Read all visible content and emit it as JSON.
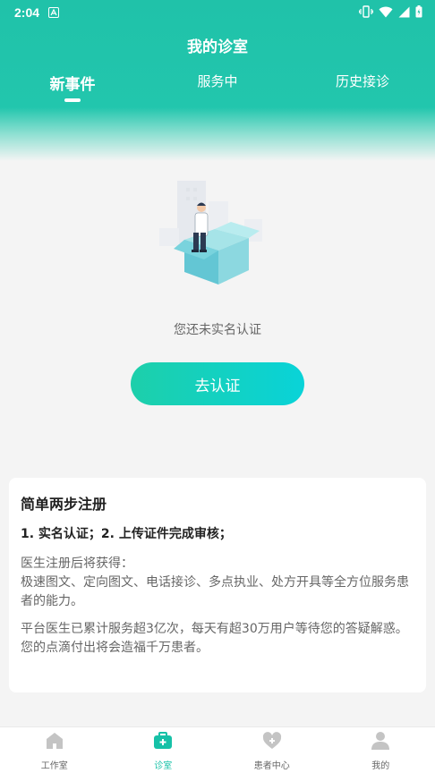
{
  "status_bar": {
    "time": "2:04"
  },
  "nav": {
    "title": "我的诊室"
  },
  "tabs": [
    {
      "label": "新事件",
      "active": true
    },
    {
      "label": "服务中",
      "active": false
    },
    {
      "label": "历史接诊",
      "active": false
    }
  ],
  "empty_state": {
    "message": "您还未实名认证",
    "button_label": "去认证"
  },
  "register_card": {
    "title": "简单两步注册",
    "steps": "1. 实名认证；2. 上传证件完成审核；",
    "paragraph1": "医生注册后将获得：\n极速图文、定向图文、电话接诊、多点执业、处方开具等全方位服务患者的能力。",
    "paragraph2": "平台医生已累计服务超3亿次，每天有超30万用户等待您的答疑解惑。您的点滴付出将会造福千万患者。"
  },
  "tabbar": {
    "items": [
      {
        "label": "工作室",
        "icon": "home-icon",
        "active": false
      },
      {
        "label": "诊室",
        "icon": "medical-kit-icon",
        "active": true
      },
      {
        "label": "患者中心",
        "icon": "heart-plus-icon",
        "active": false
      },
      {
        "label": "我的",
        "icon": "person-icon",
        "active": false
      }
    ]
  },
  "colors": {
    "primary": "#1dc3a8",
    "accent_cyan": "#09d3d8"
  }
}
